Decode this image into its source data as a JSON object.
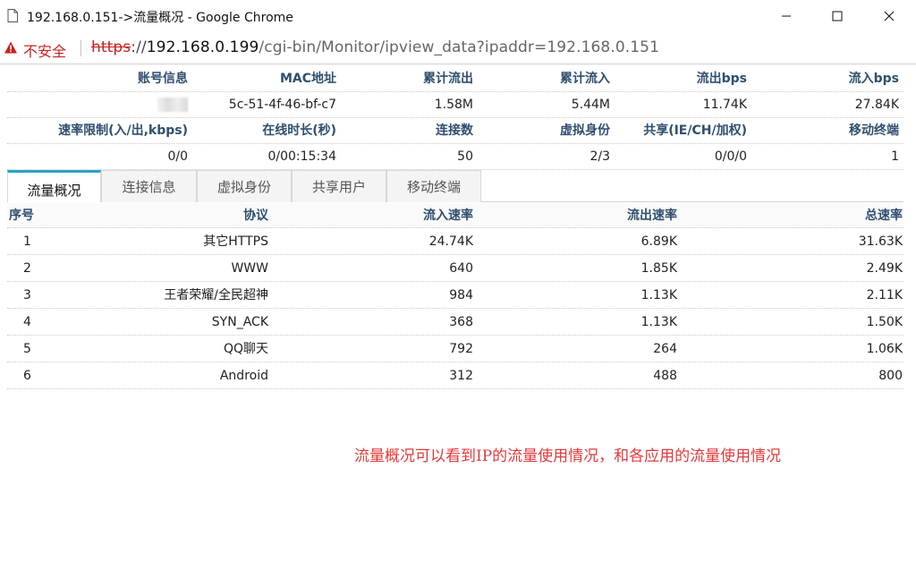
{
  "window": {
    "title": "192.168.0.151->流量概况 - Google Chrome"
  },
  "addressbar": {
    "security_label": "不安全",
    "url_scheme": "https",
    "url_sep": "://",
    "url_host": "192.168.0.199",
    "url_path": "/cgi-bin/Monitor/ipview_data?ipaddr=192.168.0.151"
  },
  "info": {
    "row1_headers": [
      "账号信息",
      "MAC地址",
      "累计流出",
      "累计流入",
      "流出bps",
      "流入bps"
    ],
    "row1_values": [
      "",
      "5c-51-4f-46-bf-c7",
      "1.58M",
      "5.44M",
      "11.74K",
      "27.84K"
    ],
    "row2_headers": [
      "速率限制(入/出,kbps)",
      "在线时长(秒)",
      "连接数",
      "虚拟身份",
      "共享(IE/CH/加权)",
      "移动终端"
    ],
    "row2_values": [
      "0/0",
      "0/00:15:34",
      "50",
      "2/3",
      "0/0/0",
      "1"
    ]
  },
  "tabs": [
    "流量概况",
    "连接信息",
    "虚拟身份",
    "共享用户",
    "移动终端"
  ],
  "traffic": {
    "headers": [
      "序号",
      "协议",
      "流入速率",
      "流出速率",
      "总速率"
    ],
    "rows": [
      [
        "1",
        "其它HTTPS",
        "24.74K",
        "6.89K",
        "31.63K"
      ],
      [
        "2",
        "WWW",
        "640",
        "1.85K",
        "2.49K"
      ],
      [
        "3",
        "王者荣耀/全民超神",
        "984",
        "1.13K",
        "2.11K"
      ],
      [
        "4",
        "SYN_ACK",
        "368",
        "1.13K",
        "1.50K"
      ],
      [
        "5",
        "QQ聊天",
        "792",
        "264",
        "1.06K"
      ],
      [
        "6",
        "Android",
        "312",
        "488",
        "800"
      ]
    ]
  },
  "annotation": "流量概况可以看到IP的流量使用情况，和各应用的流量使用情况",
  "colors": {
    "accent_tab": "#29a3c6",
    "header_text": "#2f4f6f",
    "insecure": "#c5221f",
    "annotation": "#e23a3a"
  }
}
